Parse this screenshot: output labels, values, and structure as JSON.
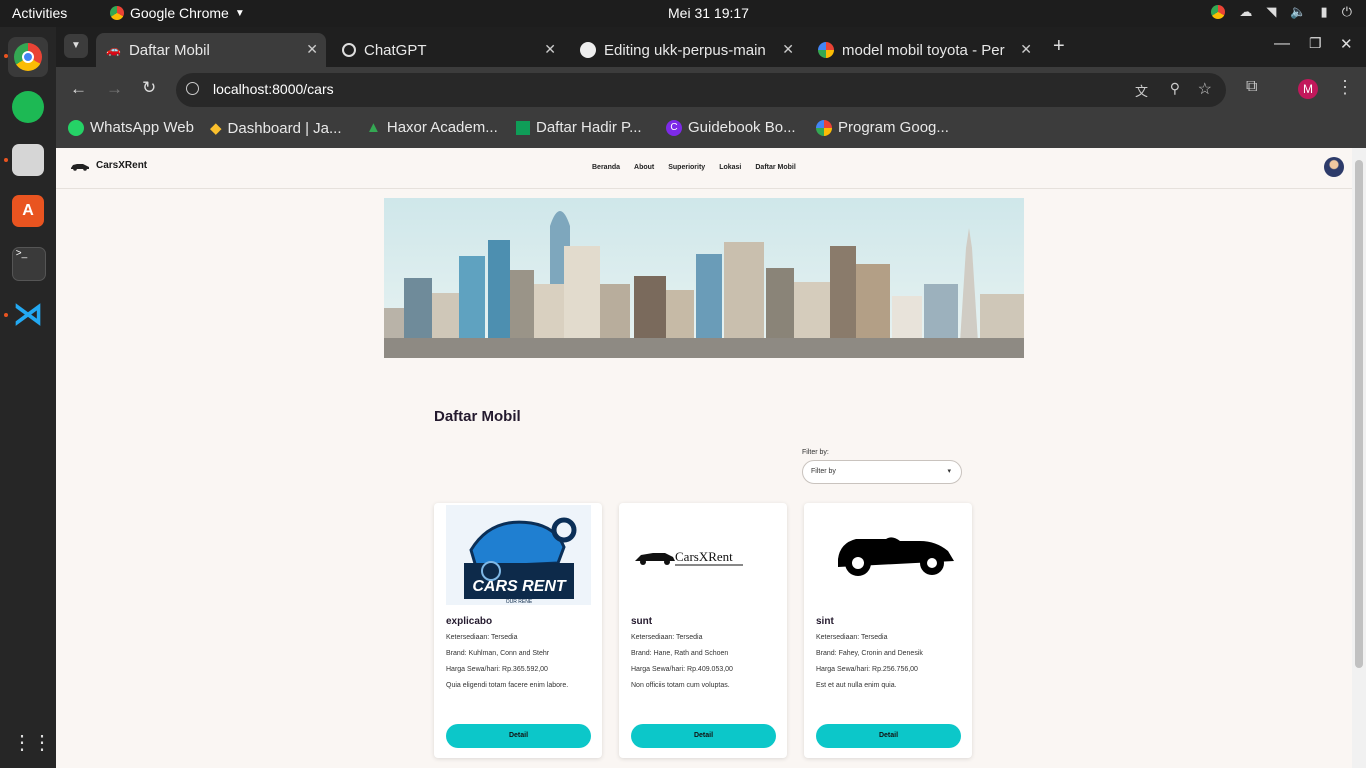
{
  "os": {
    "activities": "Activities",
    "app_name": "Google Chrome",
    "clock": "Mei 31  19:17"
  },
  "browser": {
    "tabs": [
      {
        "label": "Daftar Mobil",
        "active": true
      },
      {
        "label": "ChatGPT",
        "active": false
      },
      {
        "label": "Editing ukk-perpus-main",
        "active": false
      },
      {
        "label": "model mobil toyota - Per",
        "active": false
      }
    ],
    "url": "localhost:8000/cars",
    "profile_initial": "M",
    "bookmarks": [
      "WhatsApp Web",
      "Dashboard | Ja...",
      "Haxor Academ...",
      "Daftar Hadir P...",
      "Guidebook Bo...",
      "Program Goog..."
    ]
  },
  "site": {
    "brand": "CarsXRent",
    "nav": [
      "Beranda",
      "About",
      "Superiority",
      "Lokasi",
      "Daftar Mobil"
    ],
    "page_title": "Daftar Mobil",
    "filter": {
      "label": "Filter by:",
      "selected": "Filter by"
    },
    "cards": [
      {
        "name": "explicabo",
        "availability": "Ketersediaan: Tersedia",
        "brand": "Brand: Kuhlman, Conn and Stehr",
        "price": "Harga Sewa/hari: Rp.365.592,00",
        "description": "Quia eligendi totam facere enim labore.",
        "button": "Detail",
        "logo_text": "CARS RENT",
        "logo_sub": "OUR RENE"
      },
      {
        "name": "sunt",
        "availability": "Ketersediaan: Tersedia",
        "brand": "Brand: Hane, Rath and Schoen",
        "price": "Harga Sewa/hari: Rp.409.053,00",
        "description": "Non officiis totam cum voluptas.",
        "button": "Detail",
        "logo_text": "CarsXRent"
      },
      {
        "name": "sint",
        "availability": "Ketersediaan: Tersedia",
        "brand": "Brand: Fahey, Cronin and Denesik",
        "price": "Harga Sewa/hari: Rp.256.756,00",
        "description": "Est et aut nulla enim quia.",
        "button": "Detail"
      }
    ]
  }
}
